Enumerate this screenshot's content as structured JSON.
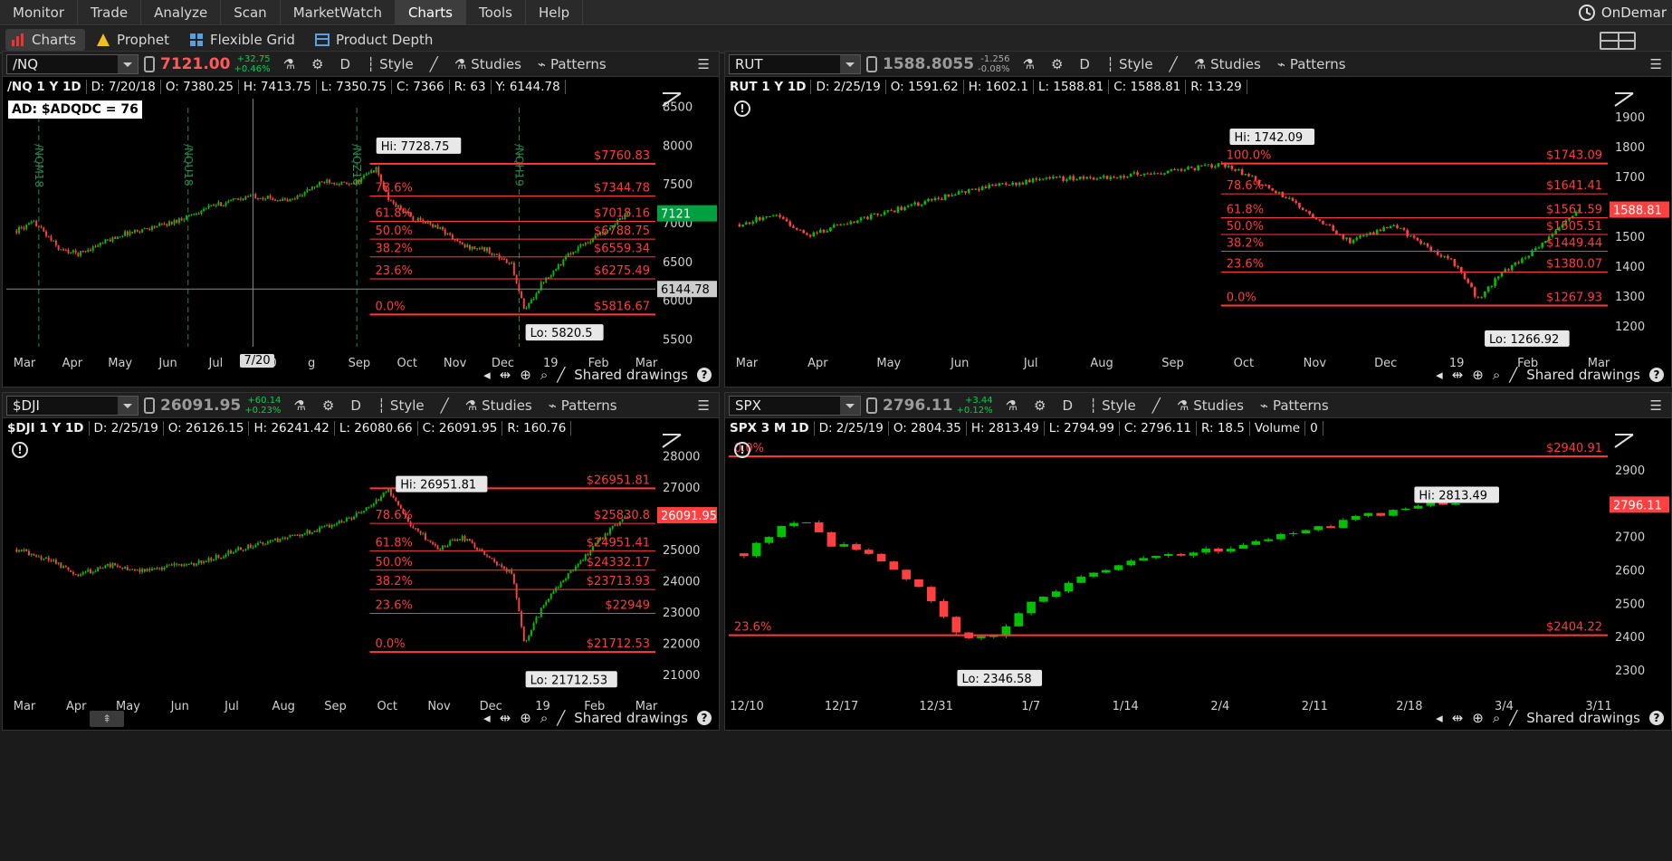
{
  "menubar": {
    "items": [
      "Monitor",
      "Trade",
      "Analyze",
      "Scan",
      "MarketWatch",
      "Charts",
      "Tools",
      "Help"
    ],
    "active": "Charts",
    "ondemand": "OnDemar"
  },
  "toolbar": {
    "items": [
      "Charts",
      "Prophet",
      "Flexible Grid",
      "Product Depth"
    ]
  },
  "panel_header_labels": {
    "style": "Style",
    "studies": "Studies",
    "patterns": "Patterns",
    "period": "D"
  },
  "footer": {
    "shared": "Shared drawings"
  },
  "colors": {
    "up": "#00c000",
    "down": "#ff4040",
    "fib": "#ff3b3b",
    "axis": "#d0d0d0",
    "pos": "#00d24a",
    "neg": "#ff5a5a"
  },
  "panels": [
    {
      "id": "nq",
      "symbol": "/NQ",
      "last": "7121.00",
      "last_color": "#ff5a5a",
      "change": "+32.75",
      "change_pct": "+0.46%",
      "info": [
        "/NQ 1 Y 1D",
        "D: 7/20/18",
        "O: 7380.25",
        "H: 7413.75",
        "L: 7350.75",
        "C: 7366",
        "R: 63",
        "Y: 6144.78"
      ],
      "ad_label": "AD: $ADQDC = 76",
      "hover_date": "7/20",
      "chart_data": {
        "type": "candlestick",
        "ylim": [
          5400,
          8600
        ],
        "y_ticks": [
          "8500",
          "8000",
          "7500",
          "7000",
          "6500",
          "6000",
          "5500"
        ],
        "x_ticks": [
          "Mar",
          "Apr",
          "May",
          "Jun",
          "Jul",
          "7/20",
          "g",
          "Sep",
          "Oct",
          "Nov",
          "Dec",
          "19",
          "Feb",
          "Mar"
        ],
        "contract_markers": [
          "/NQM18",
          "/NQU18",
          "/NQZ18",
          "/NQH19"
        ],
        "fib_levels": [
          {
            "pct": "",
            "price": "$7760.83"
          },
          {
            "pct": "78.6%",
            "price": "$7344.78"
          },
          {
            "pct": "61.8%",
            "price": "$7018.16"
          },
          {
            "pct": "50.0%",
            "price": "$6788.75"
          },
          {
            "pct": "38.2%",
            "price": "$6559.34"
          },
          {
            "pct": "23.6%",
            "price": "$6275.49"
          },
          {
            "pct": "0.0%",
            "price": "$5816.67"
          }
        ],
        "hi_label": "Hi: 7728.75",
        "lo_label": "Lo: 5820.5",
        "price_tag": "7121",
        "cursor_tag": "6144.78"
      }
    },
    {
      "id": "rut",
      "symbol": "RUT",
      "last": "1588.8055",
      "last_color": "#9a9a9a",
      "change": "-1.256",
      "change_pct": "-0.08%",
      "info": [
        "RUT 1 Y 1D",
        "D: 2/25/19",
        "O: 1591.62",
        "H: 1602.1",
        "L: 1588.81",
        "C: 1588.81",
        "R: 13.29"
      ],
      "chart_data": {
        "type": "candlestick",
        "ylim": [
          1130,
          1960
        ],
        "y_ticks": [
          "1900",
          "1800",
          "1700",
          "1600",
          "1500",
          "1400",
          "1300",
          "1200"
        ],
        "x_ticks": [
          "Mar",
          "Apr",
          "May",
          "Jun",
          "Jul",
          "Aug",
          "Sep",
          "Oct",
          "Nov",
          "Dec",
          "19",
          "Feb",
          "Mar"
        ],
        "fib_levels": [
          {
            "pct": "100.0%",
            "price": "$1743.09"
          },
          {
            "pct": "78.6%",
            "price": "$1641.41"
          },
          {
            "pct": "61.8%",
            "price": "$1561.59"
          },
          {
            "pct": "50.0%",
            "price": "$1505.51"
          },
          {
            "pct": "38.2%",
            "price": "$1449.44"
          },
          {
            "pct": "23.6%",
            "price": "$1380.07"
          },
          {
            "pct": "0.0%",
            "price": "$1267.93"
          }
        ],
        "hi_label": "Hi: 1742.09",
        "lo_label": "Lo: 1266.92",
        "price_tag": "1588.81"
      }
    },
    {
      "id": "dji",
      "symbol": "$DJI",
      "last": "26091.95",
      "last_color": "#9a9a9a",
      "change": "+60.14",
      "change_pct": "+0.23%",
      "info": [
        "$DJI 1 Y 1D",
        "D: 2/25/19",
        "O: 26126.15",
        "H: 26241.42",
        "L: 26080.66",
        "C: 26091.95",
        "R: 160.76"
      ],
      "chart_data": {
        "type": "candlestick",
        "ylim": [
          20500,
          28500
        ],
        "y_ticks": [
          "28000",
          "27000",
          "26000",
          "25000",
          "24000",
          "23000",
          "22000",
          "21000"
        ],
        "x_ticks": [
          "Mar",
          "Apr",
          "May",
          "Jun",
          "Jul",
          "Aug",
          "Sep",
          "Oct",
          "Nov",
          "Dec",
          "19",
          "Feb",
          "Mar"
        ],
        "fib_levels": [
          {
            "pct": "",
            "price": "$26951.81"
          },
          {
            "pct": "78.6%",
            "price": "$25830.8"
          },
          {
            "pct": "61.8%",
            "price": "$24951.41"
          },
          {
            "pct": "50.0%",
            "price": "$24332.17"
          },
          {
            "pct": "38.2%",
            "price": "$23713.93"
          },
          {
            "pct": "23.6%",
            "price": "$22949"
          },
          {
            "pct": "0.0%",
            "price": "$21712.53"
          }
        ],
        "hi_label": "Hi: 26951.81",
        "lo_label": "Lo: 21712.53",
        "price_tag": "26091.95"
      }
    },
    {
      "id": "spx",
      "symbol": "SPX",
      "last": "2796.11",
      "last_color": "#9a9a9a",
      "change": "+3.44",
      "change_pct": "+0.12%",
      "info": [
        "SPX 3 M 1D",
        "D: 2/25/19",
        "O: 2804.35",
        "H: 2813.49",
        "L: 2794.99",
        "C: 2796.11",
        "R: 18.5",
        "Volume",
        "0"
      ],
      "chart_data": {
        "type": "candlestick",
        "ylim": [
          2240,
          2990
        ],
        "y_ticks": [
          "2900",
          "2800",
          "2700",
          "2600",
          "2500",
          "2400",
          "2300"
        ],
        "x_ticks": [
          "12/10",
          "12/17",
          "12/31",
          "1/7",
          "1/14",
          "2/4",
          "2/11",
          "2/18",
          "3/4",
          "3/11"
        ],
        "fib_levels": [
          {
            "pct": "0.0%",
            "price": "$2940.91"
          },
          {
            "pct": "23.6%",
            "price": "$2404.22"
          }
        ],
        "hi_label": "Hi: 2813.49",
        "lo_label": "Lo: 2346.58",
        "price_tag": "2796.11"
      }
    }
  ]
}
